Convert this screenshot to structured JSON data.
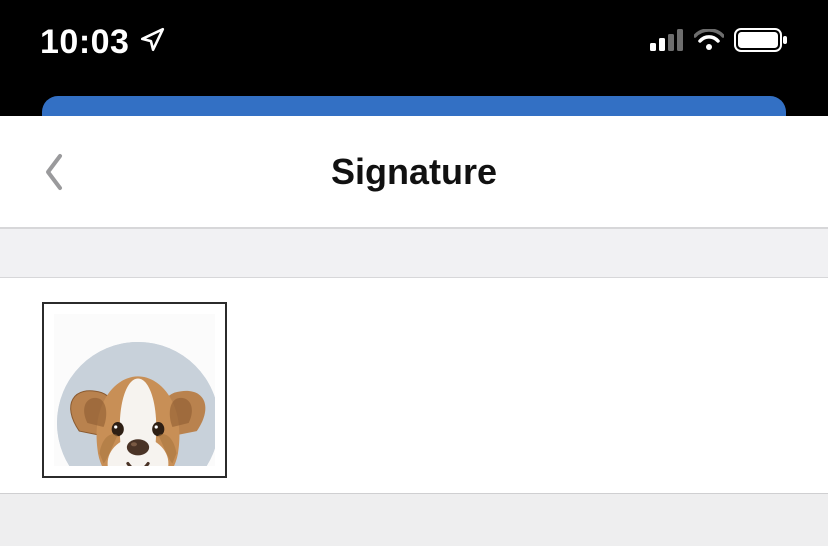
{
  "statusbar": {
    "time": "10:03"
  },
  "sheet": {
    "title": "Signature"
  },
  "thumbnail": {
    "subject": "dog-avatar"
  }
}
